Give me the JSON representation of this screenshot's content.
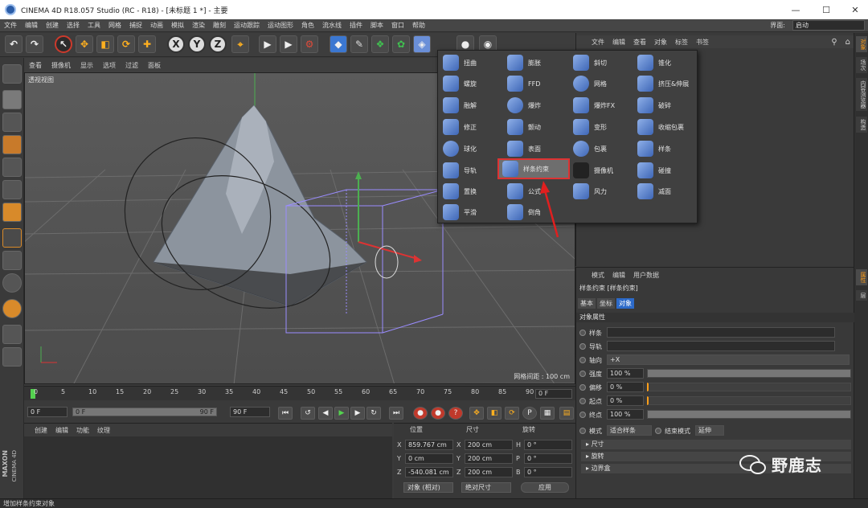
{
  "window": {
    "title": "CINEMA 4D R18.057 Studio (RC - R18) - [未标题 1 *] - 主要",
    "minimize": "—",
    "maximize": "☐",
    "close": "✕"
  },
  "menubar": {
    "items": [
      "文件",
      "编辑",
      "创建",
      "选择",
      "工具",
      "网格",
      "捕捉",
      "动画",
      "模拟",
      "渲染",
      "雕刻",
      "运动跟踪",
      "运动图形",
      "角色",
      "流水线",
      "插件",
      "脚本",
      "窗口",
      "帮助"
    ],
    "interface_label": "界面:",
    "interface_value": "启动"
  },
  "toolbar": {
    "x": "X",
    "y": "Y",
    "z": "Z"
  },
  "viewport": {
    "menu": [
      "查看",
      "摄像机",
      "显示",
      "选项",
      "过滤",
      "面板"
    ],
    "label": "透视视图",
    "grid_info": "网格间距 : 100 cm"
  },
  "timeline": {
    "ticks": [
      "0",
      "5",
      "10",
      "15",
      "20",
      "25",
      "30",
      "35",
      "40",
      "45",
      "50",
      "55",
      "60",
      "65",
      "70",
      "75",
      "80",
      "85",
      "90"
    ],
    "end_field": "0 F",
    "start_field": "0 F",
    "slider_start": "0 F",
    "slider_end": "90 F",
    "end_frame": "90 F"
  },
  "material": {
    "menu": [
      "创建",
      "编辑",
      "功能",
      "纹理"
    ],
    "brand_line1": "MAXON",
    "brand_line2": "CINEMA 4D"
  },
  "coords": {
    "headers": [
      "位置",
      "尺寸",
      "旋转"
    ],
    "rows": [
      {
        "a": "X",
        "pos": "859.767 cm",
        "b": "X",
        "size": "200 cm",
        "c": "H",
        "rot": "0 °"
      },
      {
        "a": "Y",
        "pos": "0 cm",
        "b": "Y",
        "size": "200 cm",
        "c": "P",
        "rot": "0 °"
      },
      {
        "a": "Z",
        "pos": "-540.081 cm",
        "b": "Z",
        "size": "200 cm",
        "c": "B",
        "rot": "0 °"
      }
    ],
    "mode": "对象 (相对)",
    "size_mode": "绝对尺寸",
    "apply": "应用"
  },
  "status": "增加样条约束对象",
  "objects": {
    "menu": [
      "文件",
      "编辑",
      "查看",
      "对象",
      "标签",
      "书签"
    ]
  },
  "sidetabs": [
    "对象",
    "场次",
    "内容浏览器",
    "构造",
    "属性",
    "层"
  ],
  "attributes": {
    "menu": [
      "模式",
      "编辑",
      "用户数据"
    ],
    "title": "样条约束 [样条约束]",
    "tabs": [
      "基本",
      "坐标",
      "对象"
    ],
    "section": "对象属性",
    "spline_label": "样条",
    "rail_label": "导轨",
    "axis_label": "轴向",
    "axis_value": "+X",
    "strength_label": "强度",
    "strength_value": "100 %",
    "offset_label": "偏移",
    "offset_value": "0 %",
    "start_label": "起点",
    "start_value": "0 %",
    "end_label": "终点",
    "end_value": "100 %",
    "mode_label": "模式",
    "mode_value": "适合样条",
    "endmode_label": "结束模式",
    "endmode_value": "延伸",
    "folds": [
      "尺寸",
      "旋转",
      "边界盒"
    ]
  },
  "popup": {
    "col1": [
      "扭曲",
      "螺旋",
      "融解",
      "修正",
      "球化",
      "导轨",
      "置换",
      "平滑"
    ],
    "col2": [
      "膨胀",
      "FFD",
      "爆炸",
      "颤动",
      "表面",
      "样条约束",
      "公式",
      "倒角"
    ],
    "col3": [
      "斜切",
      "网格",
      "爆炸FX",
      "变形",
      "包裹",
      "摄像机",
      "风力"
    ],
    "col4": [
      "锥化",
      "挤压&伸展",
      "破碎",
      "收缩包裹",
      "样条",
      "碰撞",
      "减面"
    ],
    "highlighted": "样条约束"
  },
  "watermark": "野鹿志",
  "colors": {
    "accent": "#ff9f1a",
    "highlight_border": "#dd3333",
    "selection_blue": "#2c6ac9",
    "playhead": "#54d24f"
  }
}
